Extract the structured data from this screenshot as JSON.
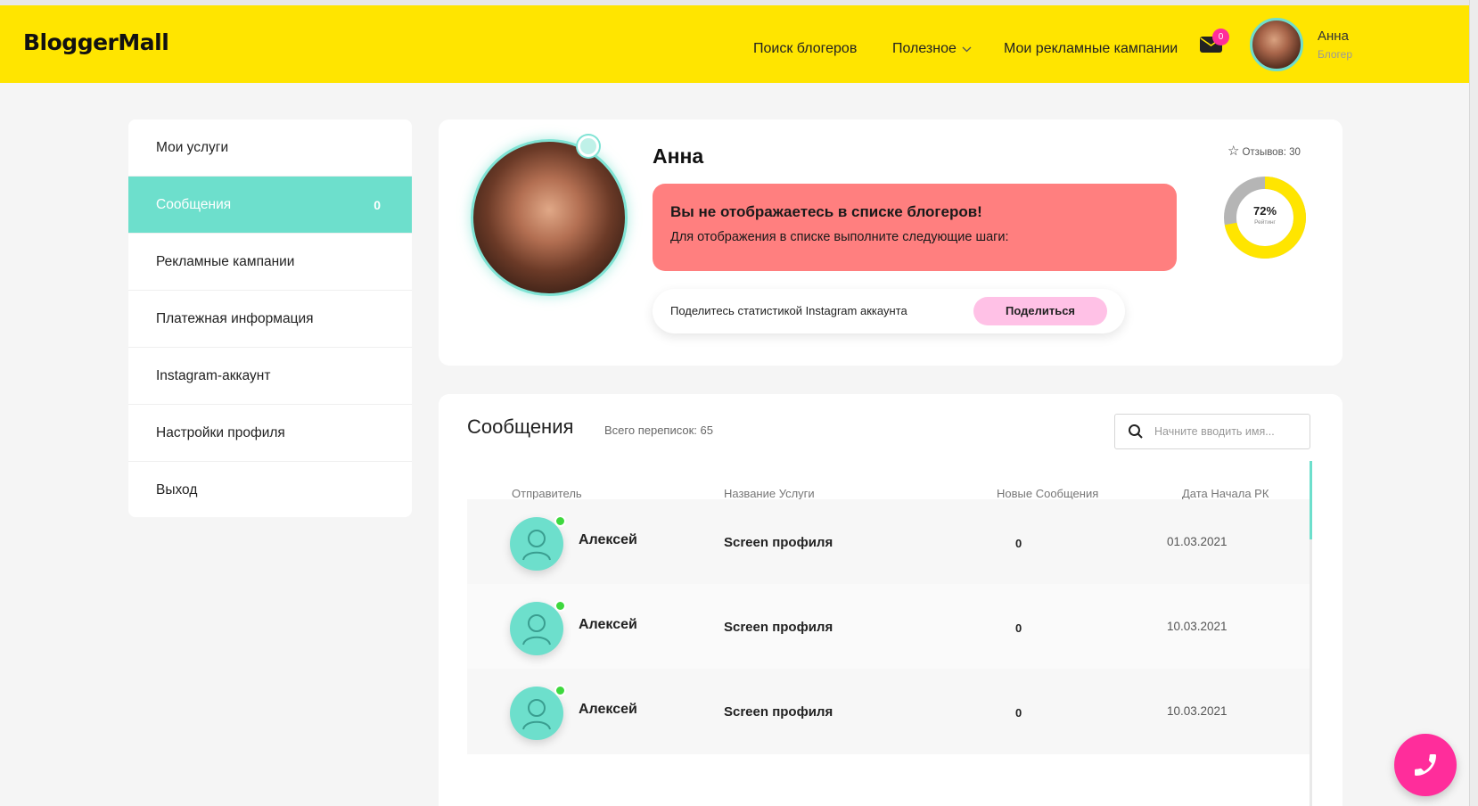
{
  "header": {
    "logo": "BloggerMall",
    "nav": {
      "search": "Поиск блогеров",
      "useful": "Полезное",
      "campaigns": "Мои рекламные кампании"
    },
    "mail_count": "0",
    "user": {
      "name": "Анна",
      "role": "Блогер"
    }
  },
  "sidebar": {
    "items": [
      {
        "label": "Мои услуги"
      },
      {
        "label": "Сообщения",
        "count": "0"
      },
      {
        "label": "Рекламные кампании"
      },
      {
        "label": "Платежная информация"
      },
      {
        "label": "Instagram-аккаунт"
      },
      {
        "label": "Настройки профиля"
      },
      {
        "label": "Выход"
      }
    ]
  },
  "profile": {
    "name": "Анна",
    "alert_title": "Вы не отображаетесь в списке блогеров!",
    "alert_text": "Для отображения в списке выполните следующие шаги:",
    "share_text": "Поделитесь статистикой Instagram аккаунта",
    "share_button": "Поделиться",
    "reviews": "Отзывов: 30",
    "rating": {
      "value_text": "72%",
      "value": 72,
      "label": "Рейтинг"
    }
  },
  "messages": {
    "title": "Сообщения",
    "total": "Всего переписок: 65",
    "search_placeholder": "Начните вводить имя...",
    "columns": {
      "sender": "Отправитель",
      "service": "Название Услуги",
      "new": "Новые Сообщения",
      "date": "Дата Начала РК"
    },
    "rows": [
      {
        "sender": "Алексей",
        "service": "Screen профиля",
        "new": "0",
        "date": "01.03.2021"
      },
      {
        "sender": "Алексей",
        "service": "Screen профиля",
        "new": "0",
        "date": "10.03.2021"
      },
      {
        "sender": "Алексей",
        "service": "Screen профиля",
        "new": "0",
        "date": "10.03.2021"
      }
    ]
  },
  "colors": {
    "brand_yellow": "#ffe500",
    "accent_teal": "#6ddfcc",
    "alert_red": "#ff7f7f",
    "share_pink": "#ffc1e6",
    "call_pink": "#ff2d9b",
    "online_green": "#3ed83e"
  },
  "icons": {
    "mail": "mail-icon",
    "chevron": "chevron-down-icon",
    "star": "star-icon",
    "search": "search-icon",
    "user": "user-icon",
    "phone": "phone-icon"
  }
}
